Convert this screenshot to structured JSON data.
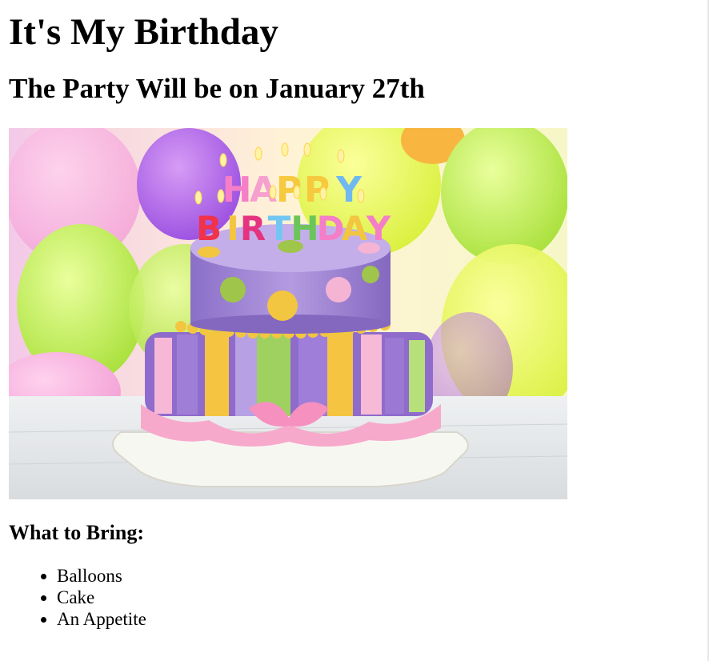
{
  "page": {
    "title": "It's My Birthday",
    "subtitle": "The Party Will be on January 27th",
    "image": {
      "alt": "Birthday cake",
      "candle_text_top": "HAPPY",
      "candle_text_bottom": "BIRTHDAY"
    },
    "bring_heading": "What to Bring:",
    "bring_items": [
      "Balloons",
      "Cake",
      "An Appetite"
    ]
  },
  "colors": {
    "text": "#000000",
    "background": "#ffffff"
  }
}
